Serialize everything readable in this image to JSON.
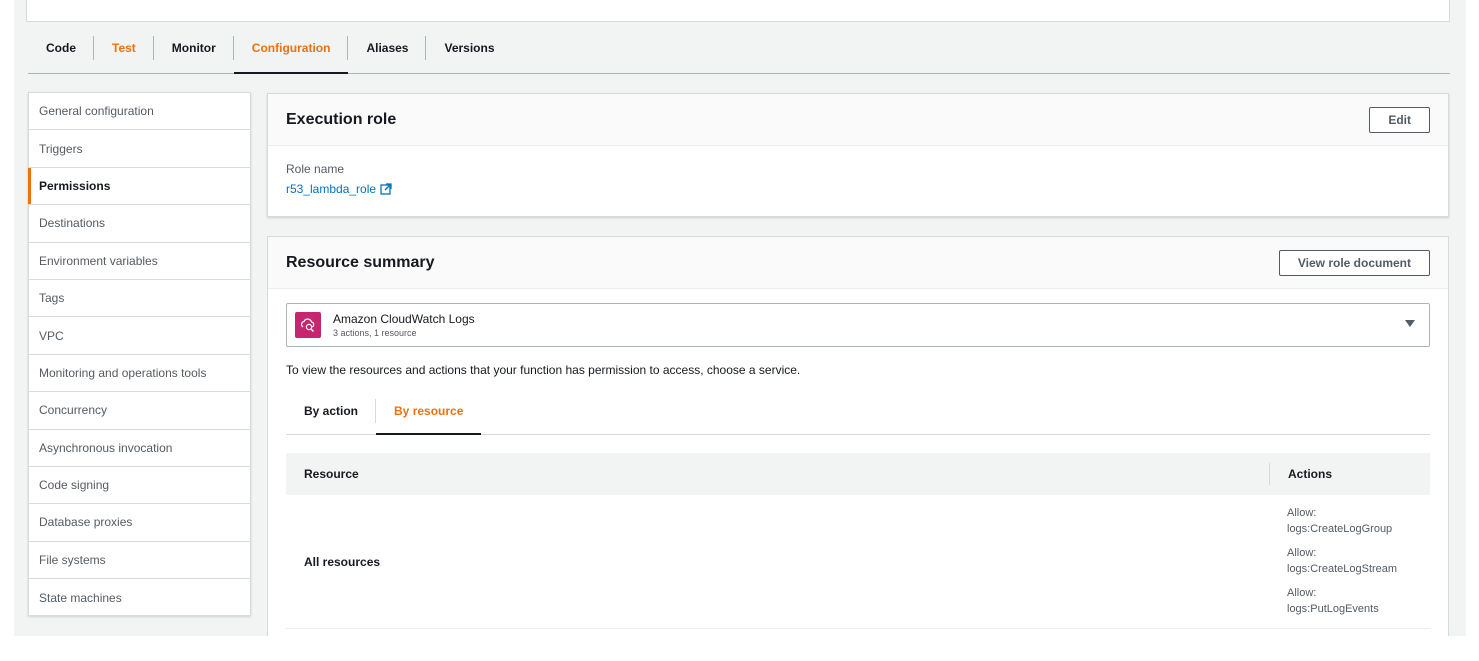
{
  "tabs": [
    {
      "label": "Code"
    },
    {
      "label": "Test"
    },
    {
      "label": "Monitor"
    },
    {
      "label": "Configuration"
    },
    {
      "label": "Aliases"
    },
    {
      "label": "Versions"
    }
  ],
  "sidebar": {
    "items": [
      {
        "label": "General configuration"
      },
      {
        "label": "Triggers"
      },
      {
        "label": "Permissions"
      },
      {
        "label": "Destinations"
      },
      {
        "label": "Environment variables"
      },
      {
        "label": "Tags"
      },
      {
        "label": "VPC"
      },
      {
        "label": "Monitoring and operations tools"
      },
      {
        "label": "Concurrency"
      },
      {
        "label": "Asynchronous invocation"
      },
      {
        "label": "Code signing"
      },
      {
        "label": "Database proxies"
      },
      {
        "label": "File systems"
      },
      {
        "label": "State machines"
      }
    ]
  },
  "execution_role": {
    "title": "Execution role",
    "edit_label": "Edit",
    "role_name_label": "Role name",
    "role_name": "r53_lambda_role"
  },
  "resource_summary": {
    "title": "Resource summary",
    "view_doc_label": "View role document",
    "service": {
      "name": "Amazon CloudWatch Logs",
      "sub": "3 actions, 1 resource",
      "icon": "cloudwatch-logs-icon"
    },
    "hint": "To view the resources and actions that your function has permission to access, choose a service.",
    "subtabs": [
      {
        "label": "By action"
      },
      {
        "label": "By resource"
      }
    ],
    "table": {
      "headers": {
        "resource": "Resource",
        "actions": "Actions"
      },
      "rows": [
        {
          "resource": "All resources",
          "actions": [
            {
              "effect": "Allow:",
              "action": "logs:CreateLogGroup"
            },
            {
              "effect": "Allow:",
              "action": "logs:CreateLogStream"
            },
            {
              "effect": "Allow:",
              "action": "logs:PutLogEvents"
            }
          ]
        }
      ]
    }
  },
  "colors": {
    "accent": "#ec7211",
    "link": "#0073bb",
    "service_icon_bg": "#c7256f"
  }
}
